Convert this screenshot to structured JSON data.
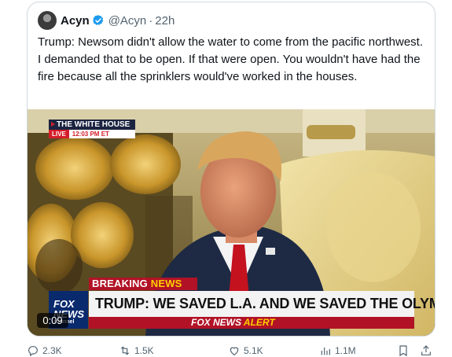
{
  "tweet": {
    "author_name": "Acyn",
    "handle": "@Acyn",
    "separator": "·",
    "time": "22h",
    "text": "Trump: Newsom didn't allow the water to come from the pacific northwest. I demanded that to be open. If that were open. You wouldn't have had the fire because all the sprinklers would've worked in the houses."
  },
  "video": {
    "location": "THE WHITE HOUSE",
    "live_label": "LIVE",
    "live_time": "12:03 PM ET",
    "breaking_label": "BREAKING",
    "breaking_news": "NEWS",
    "headline": "TRUMP: WE SAVED L.A. AND WE SAVED THE OLYMPICS",
    "network_logo_line1": "FOX",
    "network_logo_line2": "NEWS",
    "network_logo_line3": "channel",
    "alert_brand": "FOX NEWS",
    "alert_label": "ALERT",
    "duration": "0:09"
  },
  "actions": [
    {
      "name": "reply-action",
      "icon": "reply-icon",
      "count": "2.3K"
    },
    {
      "name": "retweet-action",
      "icon": "retweet-icon",
      "count": "1.5K"
    },
    {
      "name": "like-action",
      "icon": "heart-icon",
      "count": "5.1K"
    },
    {
      "name": "views-action",
      "icon": "views-icon",
      "count": "1.1M"
    },
    {
      "name": "bookmark-action",
      "icon": "bookmark-icon",
      "count": ""
    },
    {
      "name": "share-action",
      "icon": "share-icon",
      "count": ""
    }
  ],
  "colors": {
    "verified": "#1d9bf0",
    "fox_red": "#b11226",
    "fox_yellow": "#ffce00",
    "fox_blue": "#0a2a6e",
    "muted_text": "#536471"
  }
}
